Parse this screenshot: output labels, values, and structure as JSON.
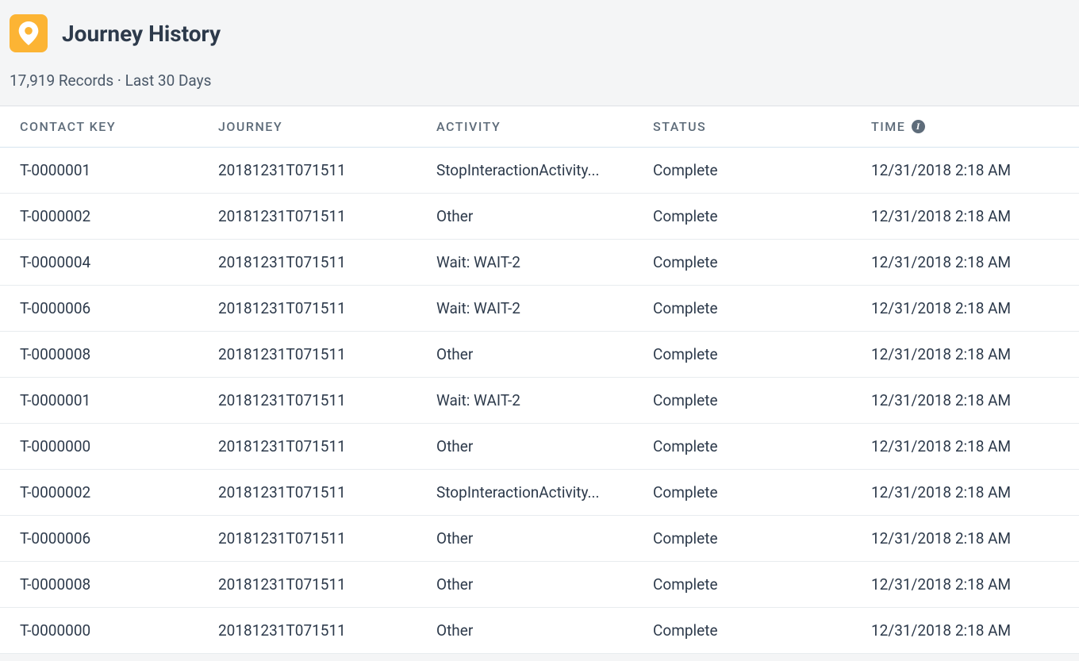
{
  "header": {
    "title": "Journey History",
    "record_count": "17,919 Records",
    "period": "Last 30 Days",
    "separator": " · "
  },
  "columns": {
    "contact_key": "CONTACT KEY",
    "journey": "JOURNEY",
    "activity": "ACTIVITY",
    "status": "STATUS",
    "time": "TIME"
  },
  "rows": [
    {
      "contact_key": "T-0000001",
      "journey": "20181231T071511",
      "activity": "StopInteractionActivity...",
      "status": "Complete",
      "time": "12/31/2018 2:18 AM"
    },
    {
      "contact_key": "T-0000002",
      "journey": "20181231T071511",
      "activity": "Other",
      "status": "Complete",
      "time": "12/31/2018 2:18 AM"
    },
    {
      "contact_key": "T-0000004",
      "journey": "20181231T071511",
      "activity": "Wait: WAIT-2",
      "status": "Complete",
      "time": "12/31/2018 2:18 AM"
    },
    {
      "contact_key": "T-0000006",
      "journey": "20181231T071511",
      "activity": "Wait: WAIT-2",
      "status": "Complete",
      "time": "12/31/2018 2:18 AM"
    },
    {
      "contact_key": "T-0000008",
      "journey": "20181231T071511",
      "activity": "Other",
      "status": "Complete",
      "time": "12/31/2018 2:18 AM"
    },
    {
      "contact_key": "T-0000001",
      "journey": "20181231T071511",
      "activity": "Wait: WAIT-2",
      "status": "Complete",
      "time": "12/31/2018 2:18 AM"
    },
    {
      "contact_key": "T-0000000",
      "journey": "20181231T071511",
      "activity": "Other",
      "status": "Complete",
      "time": "12/31/2018 2:18 AM"
    },
    {
      "contact_key": "T-0000002",
      "journey": "20181231T071511",
      "activity": "StopInteractionActivity...",
      "status": "Complete",
      "time": "12/31/2018 2:18 AM"
    },
    {
      "contact_key": "T-0000006",
      "journey": "20181231T071511",
      "activity": "Other",
      "status": "Complete",
      "time": "12/31/2018 2:18 AM"
    },
    {
      "contact_key": "T-0000008",
      "journey": "20181231T071511",
      "activity": "Other",
      "status": "Complete",
      "time": "12/31/2018 2:18 AM"
    },
    {
      "contact_key": "T-0000000",
      "journey": "20181231T071511",
      "activity": "Other",
      "status": "Complete",
      "time": "12/31/2018 2:18 AM"
    }
  ]
}
